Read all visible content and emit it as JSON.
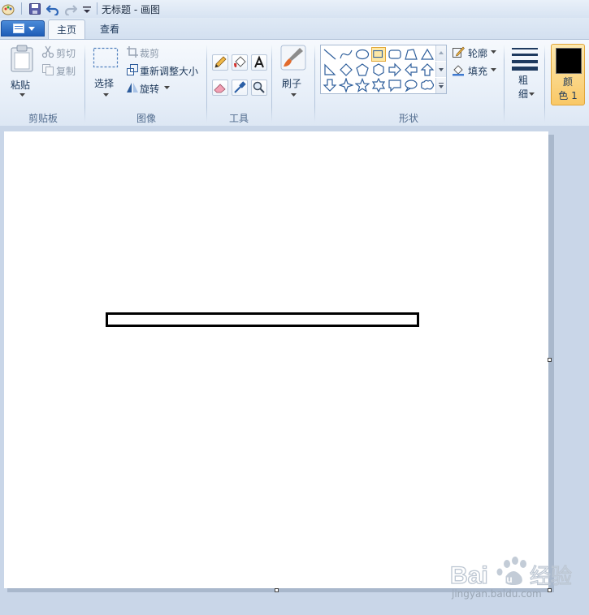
{
  "window": {
    "title": "无标题 - 画图"
  },
  "tabs": [
    {
      "label": "主页"
    },
    {
      "label": "查看"
    }
  ],
  "ribbon": {
    "clipboard": {
      "paste": "粘贴",
      "cut": "剪切",
      "copy": "复制",
      "group": "剪贴板"
    },
    "image": {
      "select": "选择",
      "crop": "裁剪",
      "resize": "重新调整大小",
      "rotate": "旋转",
      "group": "图像"
    },
    "tools": {
      "group": "工具"
    },
    "brushes": {
      "label": "刷子"
    },
    "shapes": {
      "outline": "轮廓",
      "fill": "填充",
      "group": "形状"
    },
    "size": {
      "label": "粗\n细"
    },
    "color1": {
      "label": "颜\n色 1",
      "value": "#000000"
    }
  },
  "watermark": {
    "url": "jingyan.baidu.com"
  },
  "colors": {
    "accent_selected": "#fde8a6",
    "ribbon_bg": "#e6eef8",
    "workspace_bg": "#c9d6e8",
    "canvas_bg": "#ffffff",
    "stroke": "#000000"
  }
}
